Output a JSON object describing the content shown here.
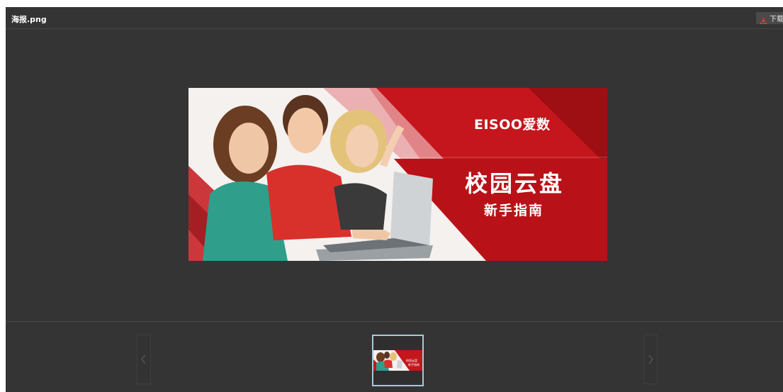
{
  "header": {
    "filename": "海报.png",
    "download_label": "下载"
  },
  "image": {
    "brand": "EISOO爱数",
    "title": "校园云盘",
    "subtitle": "新手指南"
  },
  "thumbnail": {
    "title": "校园云盘",
    "subtitle": "新手指南"
  },
  "colors": {
    "viewer_bg": "#343434",
    "banner_red": "#c4161c",
    "thumb_border": "#a6c9da",
    "download_icon": "#e0403a"
  },
  "icons": {
    "download": "download-icon",
    "prev": "chevron-left-icon",
    "next": "chevron-right-icon"
  }
}
